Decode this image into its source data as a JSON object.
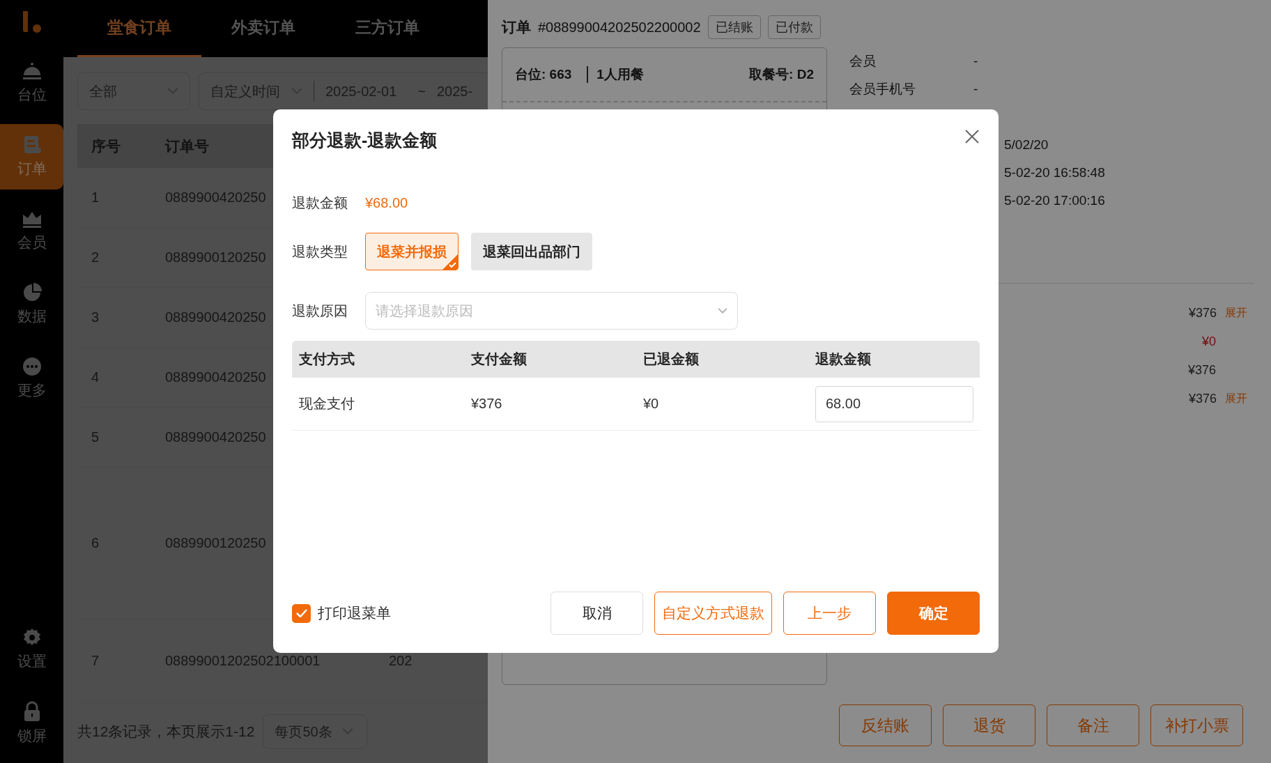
{
  "sidebar": {
    "items": [
      {
        "label": "台位",
        "selected": false
      },
      {
        "label": "订单",
        "selected": true
      },
      {
        "label": "会员",
        "selected": false
      },
      {
        "label": "数据",
        "selected": false
      },
      {
        "label": "更多",
        "selected": false
      },
      {
        "label": "设置",
        "selected": false
      },
      {
        "label": "锁屏",
        "selected": false
      }
    ]
  },
  "tabs": [
    {
      "label": "堂食订单",
      "selected": true
    },
    {
      "label": "外卖订单",
      "selected": false
    },
    {
      "label": "三方订单",
      "selected": false
    }
  ],
  "filters": {
    "status": "全部",
    "time_mode": "自定义时间",
    "date_from": "2025-02-01",
    "separator": "~",
    "date_to": "2025-"
  },
  "table": {
    "columns": [
      "序号",
      "订单号"
    ],
    "rows": [
      {
        "index": "1",
        "order_no": "0889900420250"
      },
      {
        "index": "2",
        "order_no": "0889900120250"
      },
      {
        "index": "3",
        "order_no": "0889900420250"
      },
      {
        "index": "4",
        "order_no": "0889900420250"
      },
      {
        "index": "5",
        "order_no": "0889900420250"
      },
      {
        "index": "6",
        "order_no": "0889900120250"
      },
      {
        "index": "7",
        "order_no": "08899001202502100001",
        "column_3": "202"
      }
    ]
  },
  "pagination": {
    "summary": "共12条记录，本页展示1-12",
    "page_size": "每页50条"
  },
  "order": {
    "label": "订单",
    "number": "#08899004202502200002",
    "tags": [
      "已结账",
      "已付款"
    ],
    "card": {
      "table": "台位: 663",
      "guests": "1人用餐",
      "pickup": "取餐号: D2"
    },
    "info": [
      {
        "label": "会员",
        "value": "-"
      },
      {
        "label": "会员手机号",
        "value": "-"
      },
      {
        "value": "5/02/20"
      },
      {
        "value": "5-02-20 16:58:48"
      },
      {
        "value": "5-02-20 17:00:16"
      }
    ],
    "amounts": [
      {
        "value": "¥376",
        "link": "展开",
        "kind": "normal"
      },
      {
        "value": "¥0",
        "kind": "negative"
      },
      {
        "value": "¥376",
        "kind": "normal"
      },
      {
        "value": "¥376",
        "link": "展开",
        "kind": "normal"
      }
    ],
    "actions": [
      "反结账",
      "退货",
      "备注",
      "补打小票"
    ]
  },
  "dialog": {
    "title": "部分退款-退款金额",
    "amount_label": "退款金额",
    "amount": "¥68.00",
    "type_label": "退款类型",
    "types": [
      {
        "label": "退菜并报损",
        "selected": true
      },
      {
        "label": "退菜回出品部门",
        "selected": false
      }
    ],
    "reason_label": "退款原因",
    "reason_placeholder": "请选择退款原因",
    "columns": [
      "支付方式",
      "支付金额",
      "已退金额",
      "退款金额"
    ],
    "rows": [
      {
        "method": "现金支付",
        "paid": "¥376",
        "refunded": "¥0",
        "refund": "68.00"
      }
    ],
    "print": {
      "label": "打印退菜单",
      "checked": true
    },
    "buttons": [
      {
        "label": "取消",
        "kind": "plain"
      },
      {
        "label": "自定义方式退款",
        "kind": "outline"
      },
      {
        "label": "上一步",
        "kind": "outline"
      },
      {
        "label": "确定",
        "kind": "primary"
      }
    ]
  }
}
